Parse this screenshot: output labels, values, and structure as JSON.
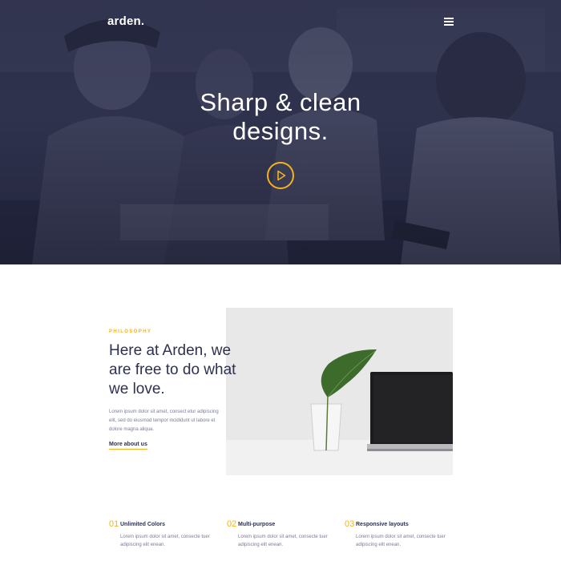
{
  "header": {
    "logo": "arden.",
    "menu_icon": "hamburger-menu-icon"
  },
  "hero": {
    "title_line1": "Sharp & clean",
    "title_line2": "designs.",
    "play_icon": "play-icon",
    "accent_color": "#f5b21b",
    "overlay_color": "#2c2f4a"
  },
  "philosophy": {
    "eyebrow": "PHILOSOPHY",
    "heading_line1": "Here at Arden, we",
    "heading_line2": "are free to do what",
    "heading_line3": "we love.",
    "body": "Lorem ipsum dolor sit amet, consect etur adipiscing elit, sed do eiusmod tempor incididunt ut labore et dolore magna aliqua.",
    "link": "More about us"
  },
  "features": [
    {
      "number": "01",
      "title": "Unlimited Colors",
      "description": "Lorem ipsum dolor sit amet, consecte tuer adipiscing elit enean."
    },
    {
      "number": "02",
      "title": "Multi-purpose",
      "description": "Lorem ipsum dolor sit amet, consecte tuer adipiscing elit enean."
    },
    {
      "number": "03",
      "title": "Responsive layouts",
      "description": "Lorem ipsum dolor sit amet, consecte tuer adipiscing elit enean."
    }
  ]
}
